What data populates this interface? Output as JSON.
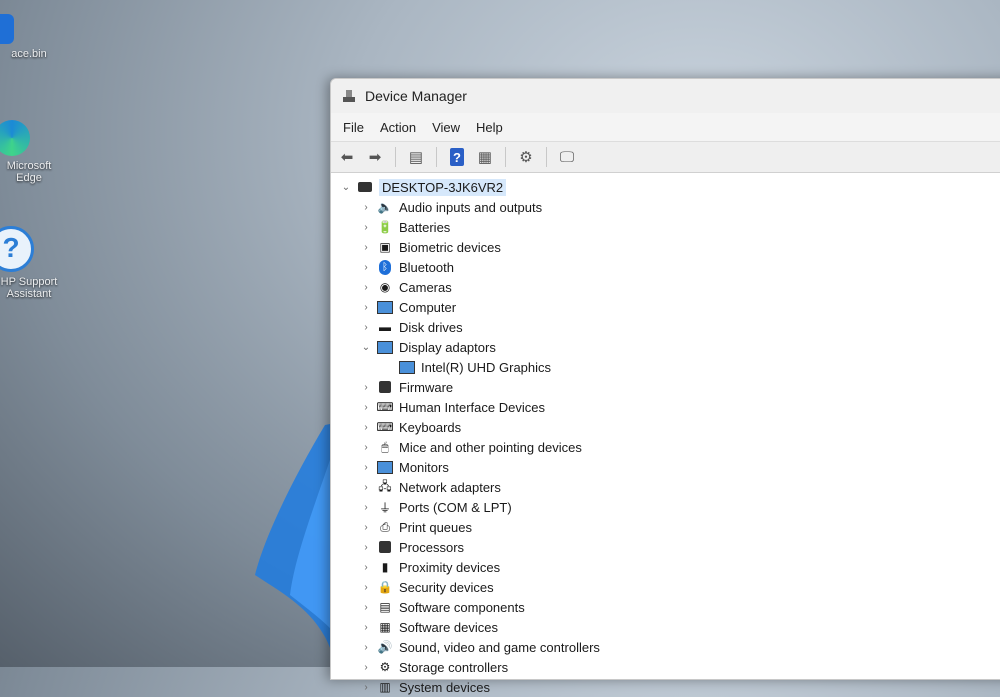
{
  "window": {
    "title": "Device Manager"
  },
  "menu": [
    "File",
    "Action",
    "View",
    "Help"
  ],
  "toolbar": [
    {
      "icon": "back-arrow-icon",
      "glyph": "⬅"
    },
    {
      "icon": "forward-arrow-icon",
      "glyph": "➡"
    },
    {
      "icon": "properties-icon",
      "glyph": "▤"
    },
    {
      "icon": "help-icon",
      "glyph": "?"
    },
    {
      "icon": "view-icon",
      "glyph": "▦"
    },
    {
      "icon": "update-driver-icon",
      "glyph": "⚙"
    },
    {
      "icon": "scan-hardware-icon",
      "glyph": "🖵"
    }
  ],
  "tree": {
    "root": {
      "label": "DESKTOP-3JK6VR2",
      "expanded": true
    },
    "categories": [
      {
        "label": "Audio inputs and outputs",
        "icon": "speaker-icon"
      },
      {
        "label": "Batteries",
        "icon": "battery-icon"
      },
      {
        "label": "Biometric devices",
        "icon": "fingerprint-icon"
      },
      {
        "label": "Bluetooth",
        "icon": "bluetooth-icon"
      },
      {
        "label": "Cameras",
        "icon": "camera-icon"
      },
      {
        "label": "Computer",
        "icon": "computer-icon"
      },
      {
        "label": "Disk drives",
        "icon": "disk-drive-icon"
      },
      {
        "label": "Display adaptors",
        "icon": "display-adapter-icon",
        "expanded": true,
        "children": [
          {
            "label": "Intel(R) UHD Graphics",
            "icon": "display-adapter-icon"
          }
        ]
      },
      {
        "label": "Firmware",
        "icon": "firmware-icon"
      },
      {
        "label": "Human Interface Devices",
        "icon": "hid-icon"
      },
      {
        "label": "Keyboards",
        "icon": "keyboard-icon"
      },
      {
        "label": "Mice and other pointing devices",
        "icon": "mouse-icon"
      },
      {
        "label": "Monitors",
        "icon": "monitor-icon"
      },
      {
        "label": "Network adapters",
        "icon": "network-adapter-icon"
      },
      {
        "label": "Ports (COM & LPT)",
        "icon": "port-icon"
      },
      {
        "label": "Print queues",
        "icon": "printer-icon"
      },
      {
        "label": "Processors",
        "icon": "processor-icon"
      },
      {
        "label": "Proximity devices",
        "icon": "proximity-icon"
      },
      {
        "label": "Security devices",
        "icon": "security-device-icon"
      },
      {
        "label": "Software components",
        "icon": "software-component-icon"
      },
      {
        "label": "Software devices",
        "icon": "software-device-icon"
      },
      {
        "label": "Sound, video and game controllers",
        "icon": "sound-icon"
      },
      {
        "label": "Storage controllers",
        "icon": "storage-controller-icon"
      },
      {
        "label": "System devices",
        "icon": "system-device-icon"
      }
    ]
  },
  "desktop": {
    "icons": [
      {
        "label": "ace.bin",
        "icon": "app-icon"
      },
      {
        "label": "Microsoft Edge",
        "icon": "edge-icon"
      },
      {
        "label": "HP Support Assistant",
        "icon": "support-assistant-icon"
      }
    ]
  }
}
